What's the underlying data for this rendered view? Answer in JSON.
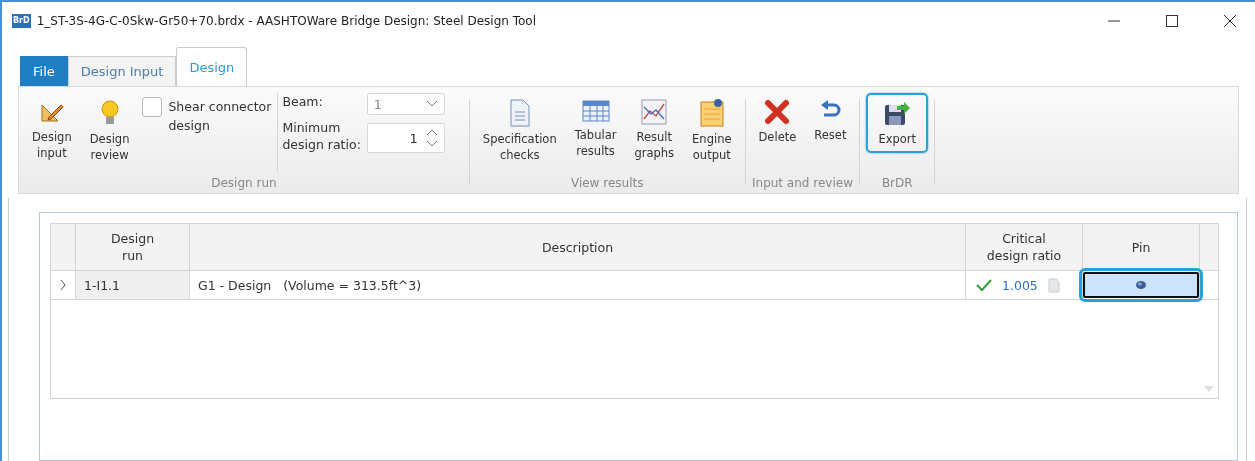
{
  "window": {
    "app_icon": "BrD",
    "title": "1_ST-3S-4G-C-0Skw-Gr50+70.brdx - AASHTOWare Bridge Design: Steel Design Tool"
  },
  "tabs": [
    {
      "label": "File",
      "kind": "file",
      "selected": false
    },
    {
      "label": "Design Input",
      "kind": "tab",
      "selected": false
    },
    {
      "label": "Design",
      "kind": "tab",
      "selected": true
    }
  ],
  "ribbon": {
    "groups": [
      {
        "label": "Design run",
        "items": [
          {
            "kind": "button",
            "label": "Design\ninput",
            "highlighted": false
          },
          {
            "kind": "button",
            "label": "Design\nreview",
            "highlighted": false
          },
          {
            "kind": "checkbox",
            "label": "Shear connector\ndesign",
            "checked": false
          },
          {
            "kind": "fields",
            "fields": [
              {
                "kind": "dropdown",
                "label": "Beam:",
                "value": "1"
              },
              {
                "kind": "spinner",
                "label": "Minimum\ndesign ratio:",
                "value": "1"
              }
            ]
          }
        ]
      },
      {
        "label": "View results",
        "items": [
          {
            "kind": "button",
            "label": "Specification\nchecks",
            "highlighted": false
          },
          {
            "kind": "button",
            "label": "Tabular\nresults",
            "highlighted": false
          },
          {
            "kind": "button",
            "label": "Result\ngraphs",
            "highlighted": false
          },
          {
            "kind": "button",
            "label": "Engine\noutput",
            "highlighted": false
          }
        ]
      },
      {
        "label": "Input and review",
        "items": [
          {
            "kind": "button",
            "label": "Delete",
            "highlighted": false
          },
          {
            "kind": "button",
            "label": "Reset",
            "highlighted": false
          }
        ]
      },
      {
        "label": "BrDR",
        "items": [
          {
            "kind": "button",
            "label": "Export",
            "highlighted": true
          }
        ]
      }
    ]
  },
  "table": {
    "columns": [
      "Design\nrun",
      "Description",
      "Critical\ndesign ratio",
      "Pin"
    ],
    "rows": [
      {
        "expanded": false,
        "design_run": "1-I1.1",
        "description": "G1 - Design   (Volume = 313.5ft^3)",
        "passed": true,
        "critical_design_ratio": "1.005",
        "pin_selected": true,
        "pin_highlighted": true
      }
    ]
  }
}
